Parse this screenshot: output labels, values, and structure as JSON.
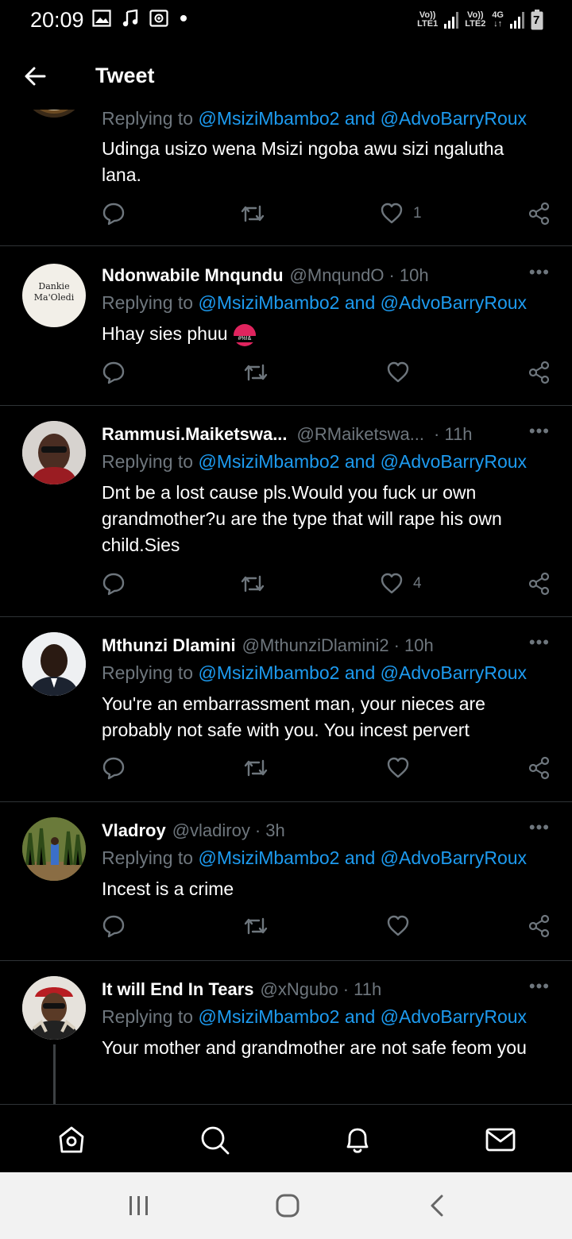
{
  "status_bar": {
    "time": "20:09",
    "sim1_label_top": "Vo))",
    "sim1_label_bottom": "LTE1",
    "sim2_label_top": "Vo))",
    "sim2_label_bottom": "LTE2",
    "network": "4G",
    "battery_level": "7"
  },
  "header": {
    "title": "Tweet"
  },
  "tweets": [
    {
      "replying_prefix": "Replying to ",
      "mention1": "@MsiziMbambo2",
      "and": " and ",
      "mention2": "@AdvoBarryRoux",
      "text": "Udinga usizo wena Msizi ngoba awu sizi ngalutha lana.",
      "likes": "1"
    },
    {
      "name": "Ndonwabile Mnqundu",
      "handle": "@MnqundO",
      "time": "· 10h",
      "avatar_text": "Dankie Ma'Oledi",
      "replying_prefix": "Replying to ",
      "mention1": "@MsiziMbambo2",
      "and": " and ",
      "mention2": "@AdvoBarryRoux",
      "text": "Hhay sies phuu",
      "emoji_text": "#%!&",
      "likes": ""
    },
    {
      "name": "Rammusi.Maiketswa...",
      "handle": "@RMaiketswa...",
      "time": "· 11h",
      "replying_prefix": "Replying to ",
      "mention1": "@MsiziMbambo2",
      "and": " and ",
      "mention2": "@AdvoBarryRoux",
      "text": "Dnt be a lost cause pls.Would you fuck ur own grandmother?u are the type that will rape his own child.Sies",
      "likes": "4"
    },
    {
      "name": "Mthunzi Dlamini",
      "handle": "@MthunziDlamini2",
      "time": "· 10h",
      "replying_prefix": "Replying to ",
      "mention1": "@MsiziMbambo2",
      "and": " and ",
      "mention2": "@AdvoBarryRoux",
      "text": "You're an embarrassment man, your nieces are probably not safe with you. You incest pervert",
      "likes": ""
    },
    {
      "name": "Vladroy",
      "handle": "@vladiroy",
      "time": "· 3h",
      "replying_prefix": "Replying to ",
      "mention1": "@MsiziMbambo2",
      "and": " and ",
      "mention2": "@AdvoBarryRoux",
      "text": "Incest is a crime",
      "likes": ""
    },
    {
      "name": "It will End In Tears",
      "handle": "@xNgubo",
      "time": "· 11h",
      "replying_prefix": "Replying to ",
      "mention1": "@MsiziMbambo2",
      "and": " and ",
      "mention2": "@AdvoBarryRoux",
      "text": "Your mother and grandmother are not safe feom you"
    }
  ],
  "more_glyph": "•••",
  "colors": {
    "background": "#000000",
    "text": "#ffffff",
    "muted": "#6e767d",
    "link": "#1d9bf0",
    "divider": "#2f3336",
    "system_nav": "#f2f2f2"
  },
  "icons": {
    "back": "arrow-left-icon",
    "reply": "comment-icon",
    "retweet": "retweet-icon",
    "like": "heart-icon",
    "share": "share-icon",
    "home": "home-icon",
    "search": "search-icon",
    "notifications": "bell-icon",
    "messages": "mail-icon"
  }
}
